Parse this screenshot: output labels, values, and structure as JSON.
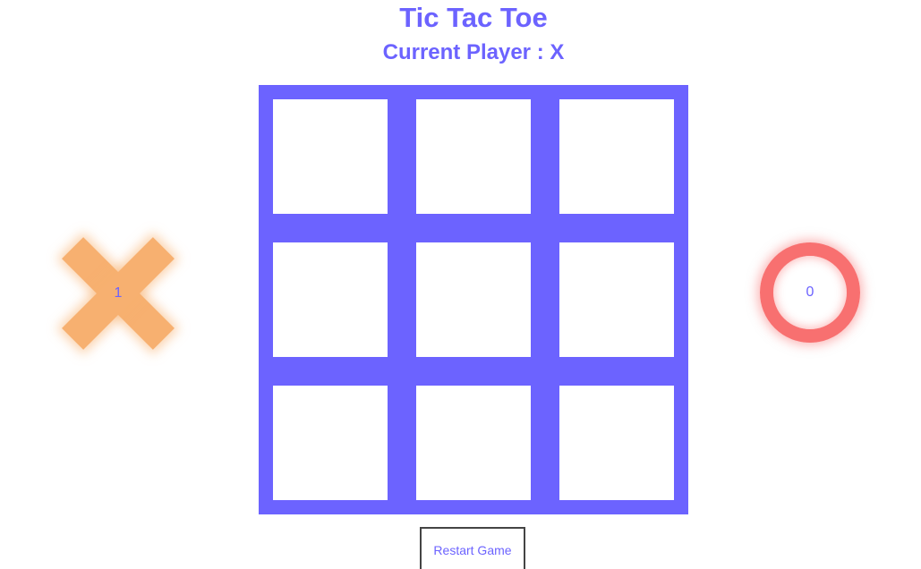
{
  "title": "Tic Tac Toe",
  "status": {
    "label": "Current Player : ",
    "player": "X",
    "text": "Current Player : X"
  },
  "board": {
    "cells": [
      "",
      "",
      "",
      "",
      "",
      "",
      "",
      "",
      ""
    ]
  },
  "scores": {
    "x": {
      "symbol": "X",
      "value": "1"
    },
    "o": {
      "symbol": "O",
      "value": "0"
    }
  },
  "controls": {
    "restart_label": "Restart Game"
  },
  "colors": {
    "accent": "#6c63ff",
    "x_marker": "#f7b070",
    "o_marker": "#f87070",
    "cell": "#ffffff"
  }
}
